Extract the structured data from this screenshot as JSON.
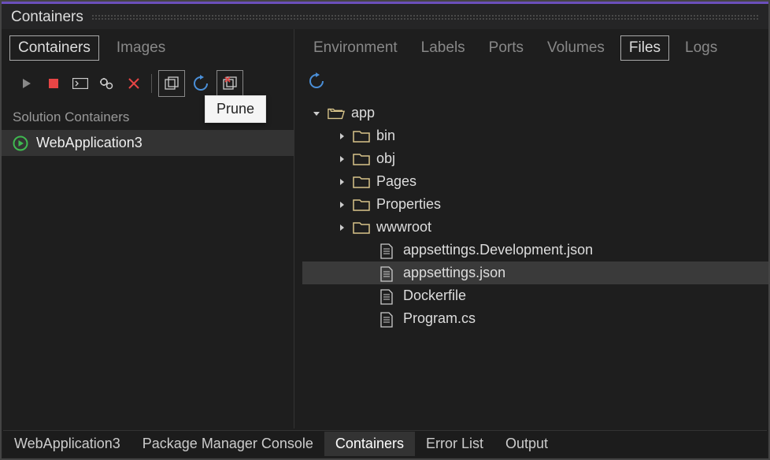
{
  "title": "Containers",
  "left": {
    "tabs": [
      {
        "label": "Containers",
        "active": true
      },
      {
        "label": "Images",
        "active": false
      }
    ],
    "tooltip": "Prune",
    "section_header": "Solution Containers",
    "items": [
      {
        "label": "WebApplication3",
        "running": true
      }
    ]
  },
  "right": {
    "tabs": [
      {
        "label": "Environment",
        "active": false
      },
      {
        "label": "Labels",
        "active": false
      },
      {
        "label": "Ports",
        "active": false
      },
      {
        "label": "Volumes",
        "active": false
      },
      {
        "label": "Files",
        "active": true
      },
      {
        "label": "Logs",
        "active": false
      }
    ],
    "tree": {
      "root": {
        "label": "app",
        "expanded": true
      },
      "folders": [
        {
          "label": "bin"
        },
        {
          "label": "obj"
        },
        {
          "label": "Pages"
        },
        {
          "label": "Properties"
        },
        {
          "label": "wwwroot"
        }
      ],
      "files": [
        {
          "label": "appsettings.Development.json",
          "selected": false
        },
        {
          "label": "appsettings.json",
          "selected": true
        },
        {
          "label": "Dockerfile",
          "selected": false
        },
        {
          "label": "Program.cs",
          "selected": false
        }
      ]
    }
  },
  "bottom_tabs": [
    {
      "label": "WebApplication3",
      "active": false
    },
    {
      "label": "Package Manager Console",
      "active": false
    },
    {
      "label": "Containers",
      "active": true
    },
    {
      "label": "Error List",
      "active": false
    },
    {
      "label": "Output",
      "active": false
    }
  ]
}
